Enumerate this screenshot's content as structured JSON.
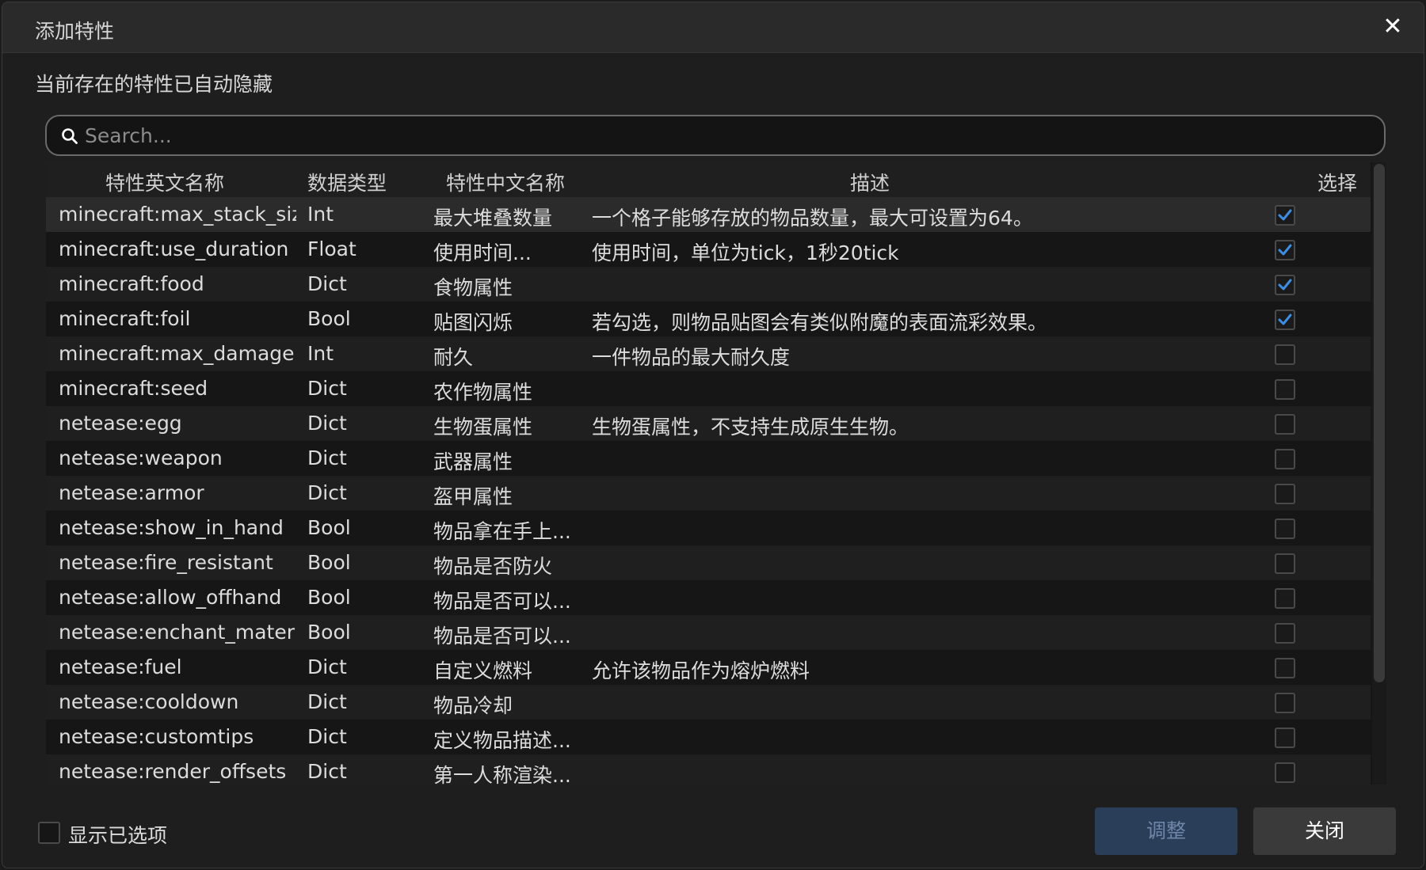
{
  "dialog": {
    "title": "添加特性",
    "close_glyph": "✕",
    "subtitle": "当前存在的特性已自动隐藏"
  },
  "search": {
    "placeholder": "Search..."
  },
  "table": {
    "headers": {
      "en_name": "特性英文名称",
      "type": "数据类型",
      "cn_name": "特性中文名称",
      "desc": "描述",
      "select": "选择"
    },
    "rows": [
      {
        "en": "minecraft:max_stack_size",
        "type": "Int",
        "cn": "最大堆叠数量",
        "desc": "一个格子能够存放的物品数量，最大可设置为64。",
        "checked": true
      },
      {
        "en": "minecraft:use_duration",
        "type": "Float",
        "cn": "使用时间...",
        "desc": "使用时间，单位为tick，1秒20tick",
        "checked": true
      },
      {
        "en": "minecraft:food",
        "type": "Dict",
        "cn": "食物属性",
        "desc": "",
        "checked": true
      },
      {
        "en": "minecraft:foil",
        "type": "Bool",
        "cn": "贴图闪烁",
        "desc": "若勾选，则物品贴图会有类似附魔的表面流彩效果。",
        "checked": true
      },
      {
        "en": "minecraft:max_damage",
        "type": "Int",
        "cn": "耐久",
        "desc": "一件物品的最大耐久度",
        "checked": false
      },
      {
        "en": "minecraft:seed",
        "type": "Dict",
        "cn": "农作物属性",
        "desc": "",
        "checked": false
      },
      {
        "en": "netease:egg",
        "type": "Dict",
        "cn": "生物蛋属性",
        "desc": "生物蛋属性，不支持生成原生生物。",
        "checked": false
      },
      {
        "en": "netease:weapon",
        "type": "Dict",
        "cn": "武器属性",
        "desc": "",
        "checked": false
      },
      {
        "en": "netease:armor",
        "type": "Dict",
        "cn": "盔甲属性",
        "desc": "",
        "checked": false
      },
      {
        "en": "netease:show_in_hand",
        "type": "Bool",
        "cn": "物品拿在手上...",
        "desc": "",
        "checked": false
      },
      {
        "en": "netease:fire_resistant",
        "type": "Bool",
        "cn": "物品是否防火",
        "desc": "",
        "checked": false
      },
      {
        "en": "netease:allow_offhand",
        "type": "Bool",
        "cn": "物品是否可以...",
        "desc": "",
        "checked": false
      },
      {
        "en": "netease:enchant_material",
        "type": "Bool",
        "cn": "物品是否可以...",
        "desc": "",
        "checked": false
      },
      {
        "en": "netease:fuel",
        "type": "Dict",
        "cn": "自定义燃料",
        "desc": "允许该物品作为熔炉燃料",
        "checked": false
      },
      {
        "en": "netease:cooldown",
        "type": "Dict",
        "cn": "物品冷却",
        "desc": "",
        "checked": false
      },
      {
        "en": "netease:customtips",
        "type": "Dict",
        "cn": "定义物品描述...",
        "desc": "",
        "checked": false
      },
      {
        "en": "netease:render_offsets",
        "type": "Dict",
        "cn": "第一人称渲染...",
        "desc": "",
        "checked": false
      }
    ]
  },
  "footer": {
    "show_selected_label": "显示已选项",
    "adjust_label": "调整",
    "close_label": "关闭"
  },
  "colors": {
    "accent_blue": "#3a8ee6",
    "adjust_button_bg": "#2a3e5a",
    "close_button_bg": "#3a3a3a"
  }
}
